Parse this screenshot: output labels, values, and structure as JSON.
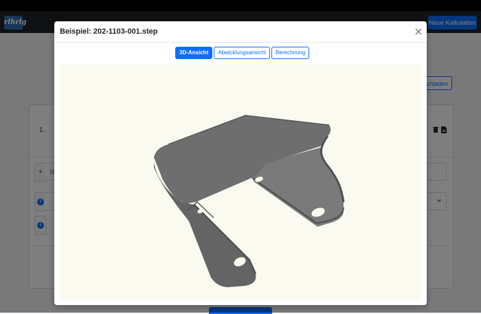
{
  "background": {
    "logo_text": "rlhrlg",
    "new_calculation_label": "Neue Kalkulation",
    "upload_label": "ochladen",
    "row_number": "1.",
    "plus_label": "+",
    "field_text": "St",
    "info_label": "i"
  },
  "modal": {
    "title": "Beispiel: 202-1103-001.step",
    "tabs": [
      {
        "label": "3D-Ansicht",
        "active": true
      },
      {
        "label": "Abwicklungsansicht",
        "active": false
      },
      {
        "label": "Berechnung",
        "active": false
      }
    ],
    "viewer_background": "#fbfaf0",
    "part_color": "#6b6b6b"
  },
  "colors": {
    "accent": "#0d6efd",
    "navbar": "#1f2327"
  }
}
